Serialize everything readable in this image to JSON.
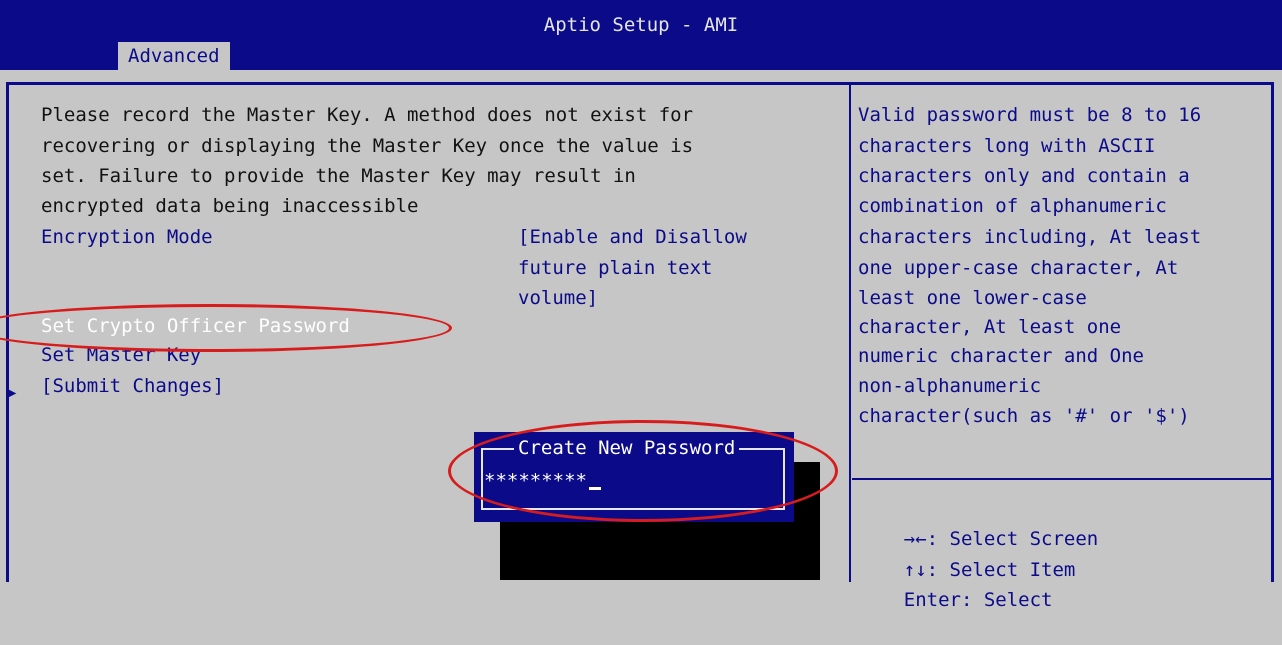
{
  "app": {
    "title": "Aptio Setup - AMI"
  },
  "tabs": [
    {
      "label": "Advanced",
      "active": true
    }
  ],
  "main": {
    "notice_lines": [
      "Please record the Master Key. A method does not exist for",
      "recovering or displaying the Master Key once the value is",
      "set. Failure to provide the Master Key may result in",
      "encrypted data being inaccessible"
    ],
    "encryption_mode": {
      "label": "Encryption Mode",
      "value_lines": [
        "[Enable and Disallow",
        "future plain text",
        "volume]"
      ]
    },
    "items": {
      "set_crypto_officer_password": "Set Crypto Officer Password",
      "set_master_key": "Set Master Key",
      "submit_changes": "[Submit Changes]"
    }
  },
  "help": {
    "lines": [
      "Valid password must be 8 to 16",
      "characters long with ASCII",
      "characters only and contain a",
      "combination of alphanumeric",
      "characters including, At least",
      "one upper-case character, At",
      "least one lower-case",
      "character, At least one",
      "numeric character and One",
      "non-alphanumeric",
      "character(such as '#' or '$')"
    ],
    "keys": [
      {
        "key": "→←",
        "action": ": Select Screen"
      },
      {
        "key": "↑↓",
        "action": ": Select Item"
      },
      {
        "key": "Enter",
        "action": ": Select"
      }
    ]
  },
  "dialog": {
    "title": "Create New Password",
    "value": "*********"
  },
  "colors": {
    "bios_blue": "#0b0b8a",
    "bios_gray": "#c6c6c6",
    "annotation_red": "#d81c1c"
  },
  "icons": {
    "submenu_arrow": "triangle-right-icon"
  }
}
